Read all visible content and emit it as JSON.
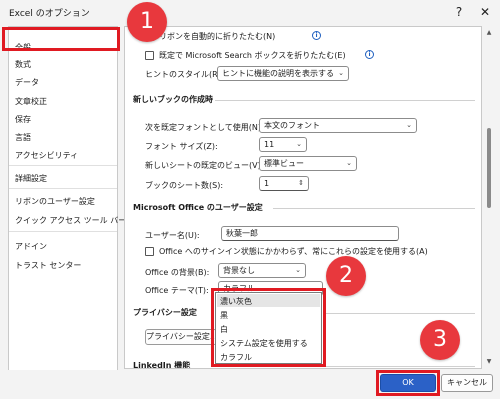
{
  "window": {
    "title": "Excel のオプション",
    "help_glyph": "?",
    "close_glyph": "✕"
  },
  "sidebar": {
    "items": [
      {
        "label": "全般"
      },
      {
        "label": "数式"
      },
      {
        "label": "データ"
      },
      {
        "label": "文章校正"
      },
      {
        "label": "保存"
      },
      {
        "label": "言語"
      },
      {
        "label": "アクセシビリティ"
      },
      {
        "label": "詳細設定"
      },
      {
        "label": "リボンのユーザー設定"
      },
      {
        "label": "クイック アクセス ツール バー"
      },
      {
        "label": "アドイン"
      },
      {
        "label": "トラスト センター"
      }
    ]
  },
  "main": {
    "ui_options": {
      "collapse_ribbon_label": "リボンを自動的に折りたたむ(N)",
      "collapse_search_label": "既定で Microsoft Search ボックスを折りたたむ(E)",
      "info_glyph": "i",
      "tooltip_style_label": "ヒントのスタイル(R):",
      "tooltip_style_value": "ヒントに機能の説明を表示する"
    },
    "new_workbook": {
      "heading": "新しいブックの作成時",
      "default_font_label": "次を既定フォントとして使用(N):",
      "default_font_value": "本文のフォント",
      "font_size_label": "フォント サイズ(Z):",
      "font_size_value": "11",
      "default_view_label": "新しいシートの既定のビュー(V):",
      "default_view_value": "標準ビュー",
      "sheet_count_label": "ブックのシート数(S):",
      "sheet_count_value": "1"
    },
    "personalize": {
      "heading": "Microsoft Office のユーザー設定",
      "username_label": "ユーザー名(U):",
      "username_value": "秋葉一郎",
      "always_use_label": "Office へのサインイン状態にかかわらず、常にこれらの設定を使用する(A)",
      "background_label": "Office の背景(B):",
      "background_value": "背景なし",
      "theme_label": "Office テーマ(T):",
      "theme_value": "カラフル"
    },
    "privacy": {
      "heading": "プライバシー設定",
      "button_label": "プライバシー設定..."
    },
    "linkedin": {
      "heading": "LinkedIn 機能"
    }
  },
  "theme_dropdown": {
    "options": [
      "濃い灰色",
      "黒",
      "白",
      "システム設定を使用する",
      "カラフル"
    ],
    "highlighted": "濃い灰色"
  },
  "footer": {
    "ok_label": "OK",
    "cancel_label": "キャンセル"
  },
  "annotations": {
    "badge1": "1",
    "badge2": "2",
    "badge3": "3",
    "color": "#e01a22"
  },
  "glyphs": {
    "dropdown_arrow": "⌄",
    "spin_arrows": "⇕",
    "scroll_up": "▲",
    "scroll_down": "▼"
  }
}
